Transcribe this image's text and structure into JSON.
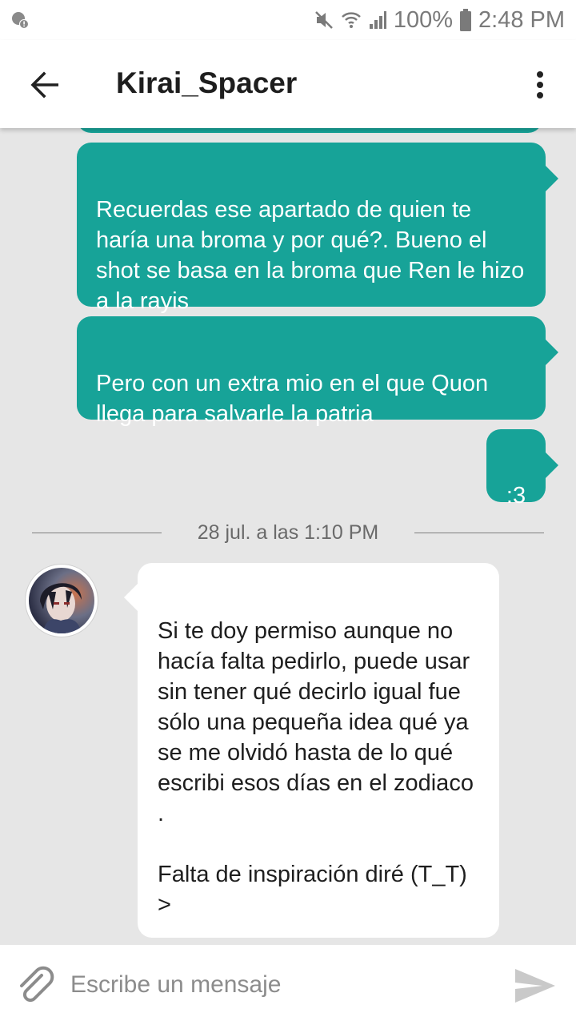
{
  "status_bar": {
    "battery": "100%",
    "time": "2:48 PM",
    "icons": [
      "notification-icon",
      "mute-icon",
      "wifi-icon",
      "signal-icon",
      "battery-icon"
    ]
  },
  "header": {
    "title": "Kirai_Spacer",
    "icons": [
      "back-arrow-icon",
      "more-vertical-icon"
    ]
  },
  "messages_outgoing": [
    {
      "text": "Recuerdas ese apartado de quien te haría una broma y por qué?. Bueno el shot se basa en la broma que Ren le hizo a la rayis"
    },
    {
      "text": "Pero con un extra mio en el que Quon llega para salvarle la patria"
    },
    {
      "text": ":3"
    }
  ],
  "date_separator": "28 jul. a las 1:10 PM",
  "message_incoming": {
    "text": "Si te doy permiso aunque no hacía falta pedirlo, puede usar sin tener qué decirlo igual fue sólo una pequeña idea qué ya se me olvidó hasta de lo qué escribi esos días en el zodiaco .\n\nFalta de inspiración diré (T_T) >"
  },
  "composer": {
    "placeholder": "Escribe un mensaje",
    "icons": [
      "paperclip-icon",
      "send-icon"
    ]
  },
  "colors": {
    "outgoing_bubble": "#17a398",
    "incoming_bubble": "#ffffff",
    "chat_background": "#e6e6e6"
  }
}
